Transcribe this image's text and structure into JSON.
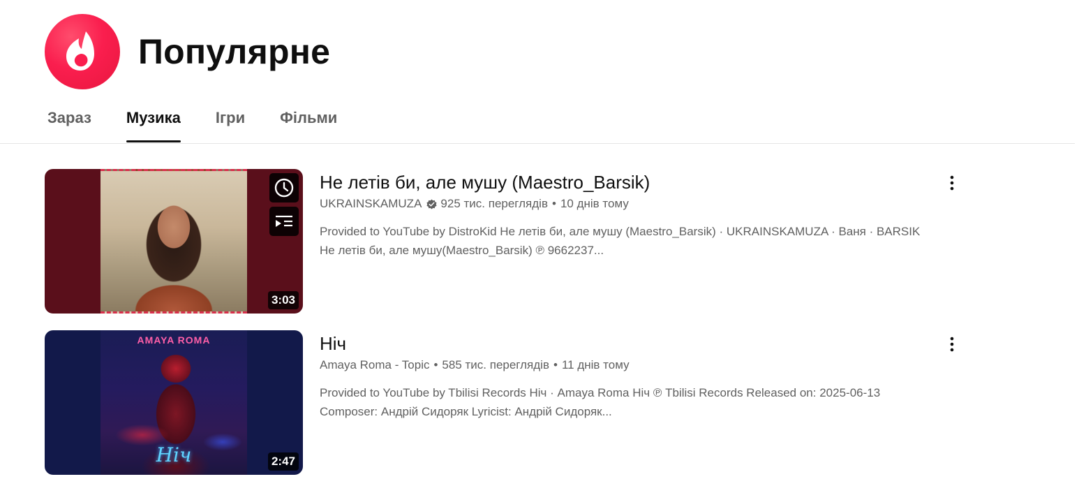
{
  "page": {
    "title": "Популярне",
    "logo_icon": "trending-flame-icon",
    "accent_color": "#fa1e4e"
  },
  "tabs": [
    {
      "label": "Зараз",
      "active": false
    },
    {
      "label": "Музика",
      "active": true
    },
    {
      "label": "Ігри",
      "active": false
    },
    {
      "label": "Фільми",
      "active": false
    }
  ],
  "videos": [
    {
      "title": "Не летів би, але мушу (Maestro_Barsik)",
      "channel": "UKRAINSKAMUZA",
      "verified": true,
      "views": "925 тис. переглядів",
      "age": "10 днів тому",
      "description_line1": "Provided to YouTube by DistroKid Не летів би, але мушу (Maestro_Barsik) · UKRAINSKAMUZA · Ваня · BARSIK",
      "description_line2": "Не летів би, але мушу(Maestro_Barsik) ℗ 9662237...",
      "duration": "3:03",
      "hover_icons": [
        "clock-icon",
        "add-to-queue-icon"
      ]
    },
    {
      "title": "Ніч",
      "channel": "Amaya Roma - Topic",
      "verified": false,
      "views": "585 тис. переглядів",
      "age": "11 днів тому",
      "description_line1": "Provided to YouTube by Tbilisi Records Ніч · Amaya Roma Ніч ℗ Tbilisi Records Released on: 2025-06-13",
      "description_line2": "Composer: Андрій Сидоряк Lyricist: Андрій Сидоряк...",
      "duration": "2:47",
      "art_title": "AMAYA ROMA",
      "art_script": "Ніч"
    }
  ],
  "separator": "•"
}
